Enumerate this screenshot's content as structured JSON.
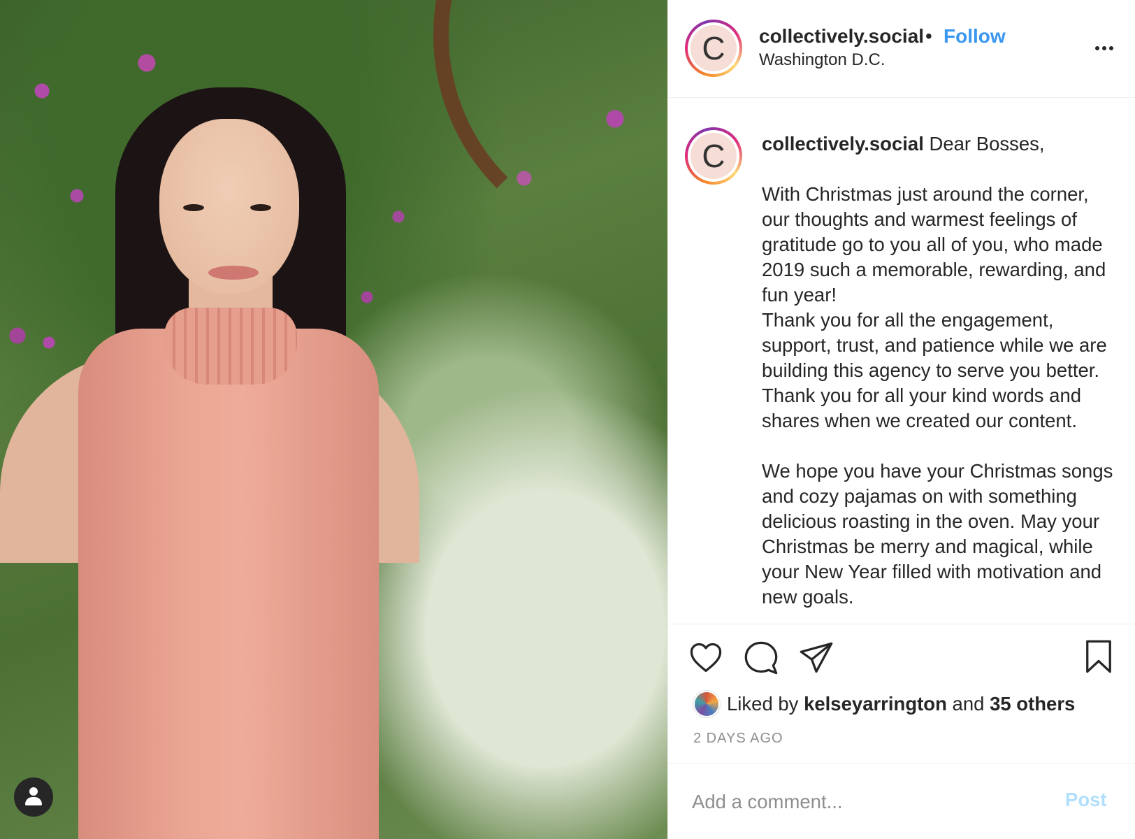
{
  "post": {
    "username": "collectively.social",
    "separator": "•",
    "follow_label": "Follow",
    "location": "Washington D.C.",
    "logo_letter": "C",
    "caption_body": " Dear Bosses,\n\nWith Christmas just around the corner, our thoughts and warmest feelings of gratitude go to you all of you, who made 2019 such a memorable, rewarding, and fun year!\nThank you for all the engagement, support, trust, and patience while we are building this agency to serve you better. Thank you for all your kind words and shares when we created our content.\n\nWe hope you have your Christmas songs and cozy pajamas on with something delicious roasting in the oven. May your Christmas be merry and magical, while your New Year filled with motivation and new goals."
  },
  "likes": {
    "prefix": "Liked by ",
    "user": "kelseyarrington",
    "middle": " and ",
    "others": "35 others"
  },
  "timestamp": "2 DAYS AGO",
  "comment": {
    "placeholder": "Add a comment...",
    "post_label": "Post"
  },
  "icons": {
    "like": "heart-icon",
    "comment": "comment-icon",
    "share": "paper-plane-icon",
    "save": "bookmark-icon",
    "more": "more-options-icon",
    "user": "user-icon"
  },
  "colors": {
    "accent": "#3897f0",
    "post_disabled": "#b2dffc",
    "muted": "#8e8e8e",
    "text": "#262626"
  }
}
